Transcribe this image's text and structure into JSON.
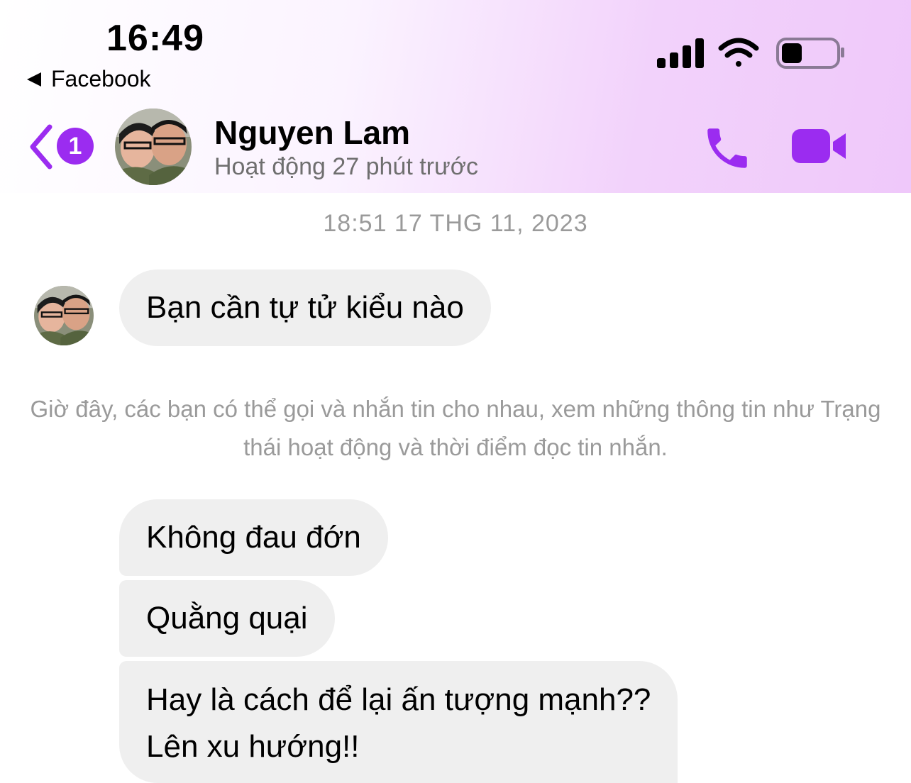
{
  "status_bar": {
    "time": "16:49",
    "back_app": "Facebook"
  },
  "header": {
    "unread_count": "1",
    "contact_name": "Nguyen Lam",
    "contact_status": "Hoạt động 27 phút trước",
    "accent_color": "#9b2cf0"
  },
  "conversation": {
    "timestamp": "18:51 17 THG 11, 2023",
    "first_message": "Bạn cần tự tử kiểu nào",
    "notice": "Giờ đây, các bạn có thể gọi và nhắn tin cho nhau, xem những thông tin như Trạng thái hoạt động và thời điểm đọc tin nhắn.",
    "messages": [
      "Không đau đớn",
      "Quằng quại",
      "Hay là cách để lại ấn tượng mạnh??",
      "Lên xu hướng!!"
    ]
  },
  "icons": {
    "signal": "cellular-signal-icon",
    "wifi": "wifi-icon",
    "battery": "battery-icon",
    "back": "chevron-left-icon",
    "call": "phone-icon",
    "video": "video-camera-icon"
  }
}
